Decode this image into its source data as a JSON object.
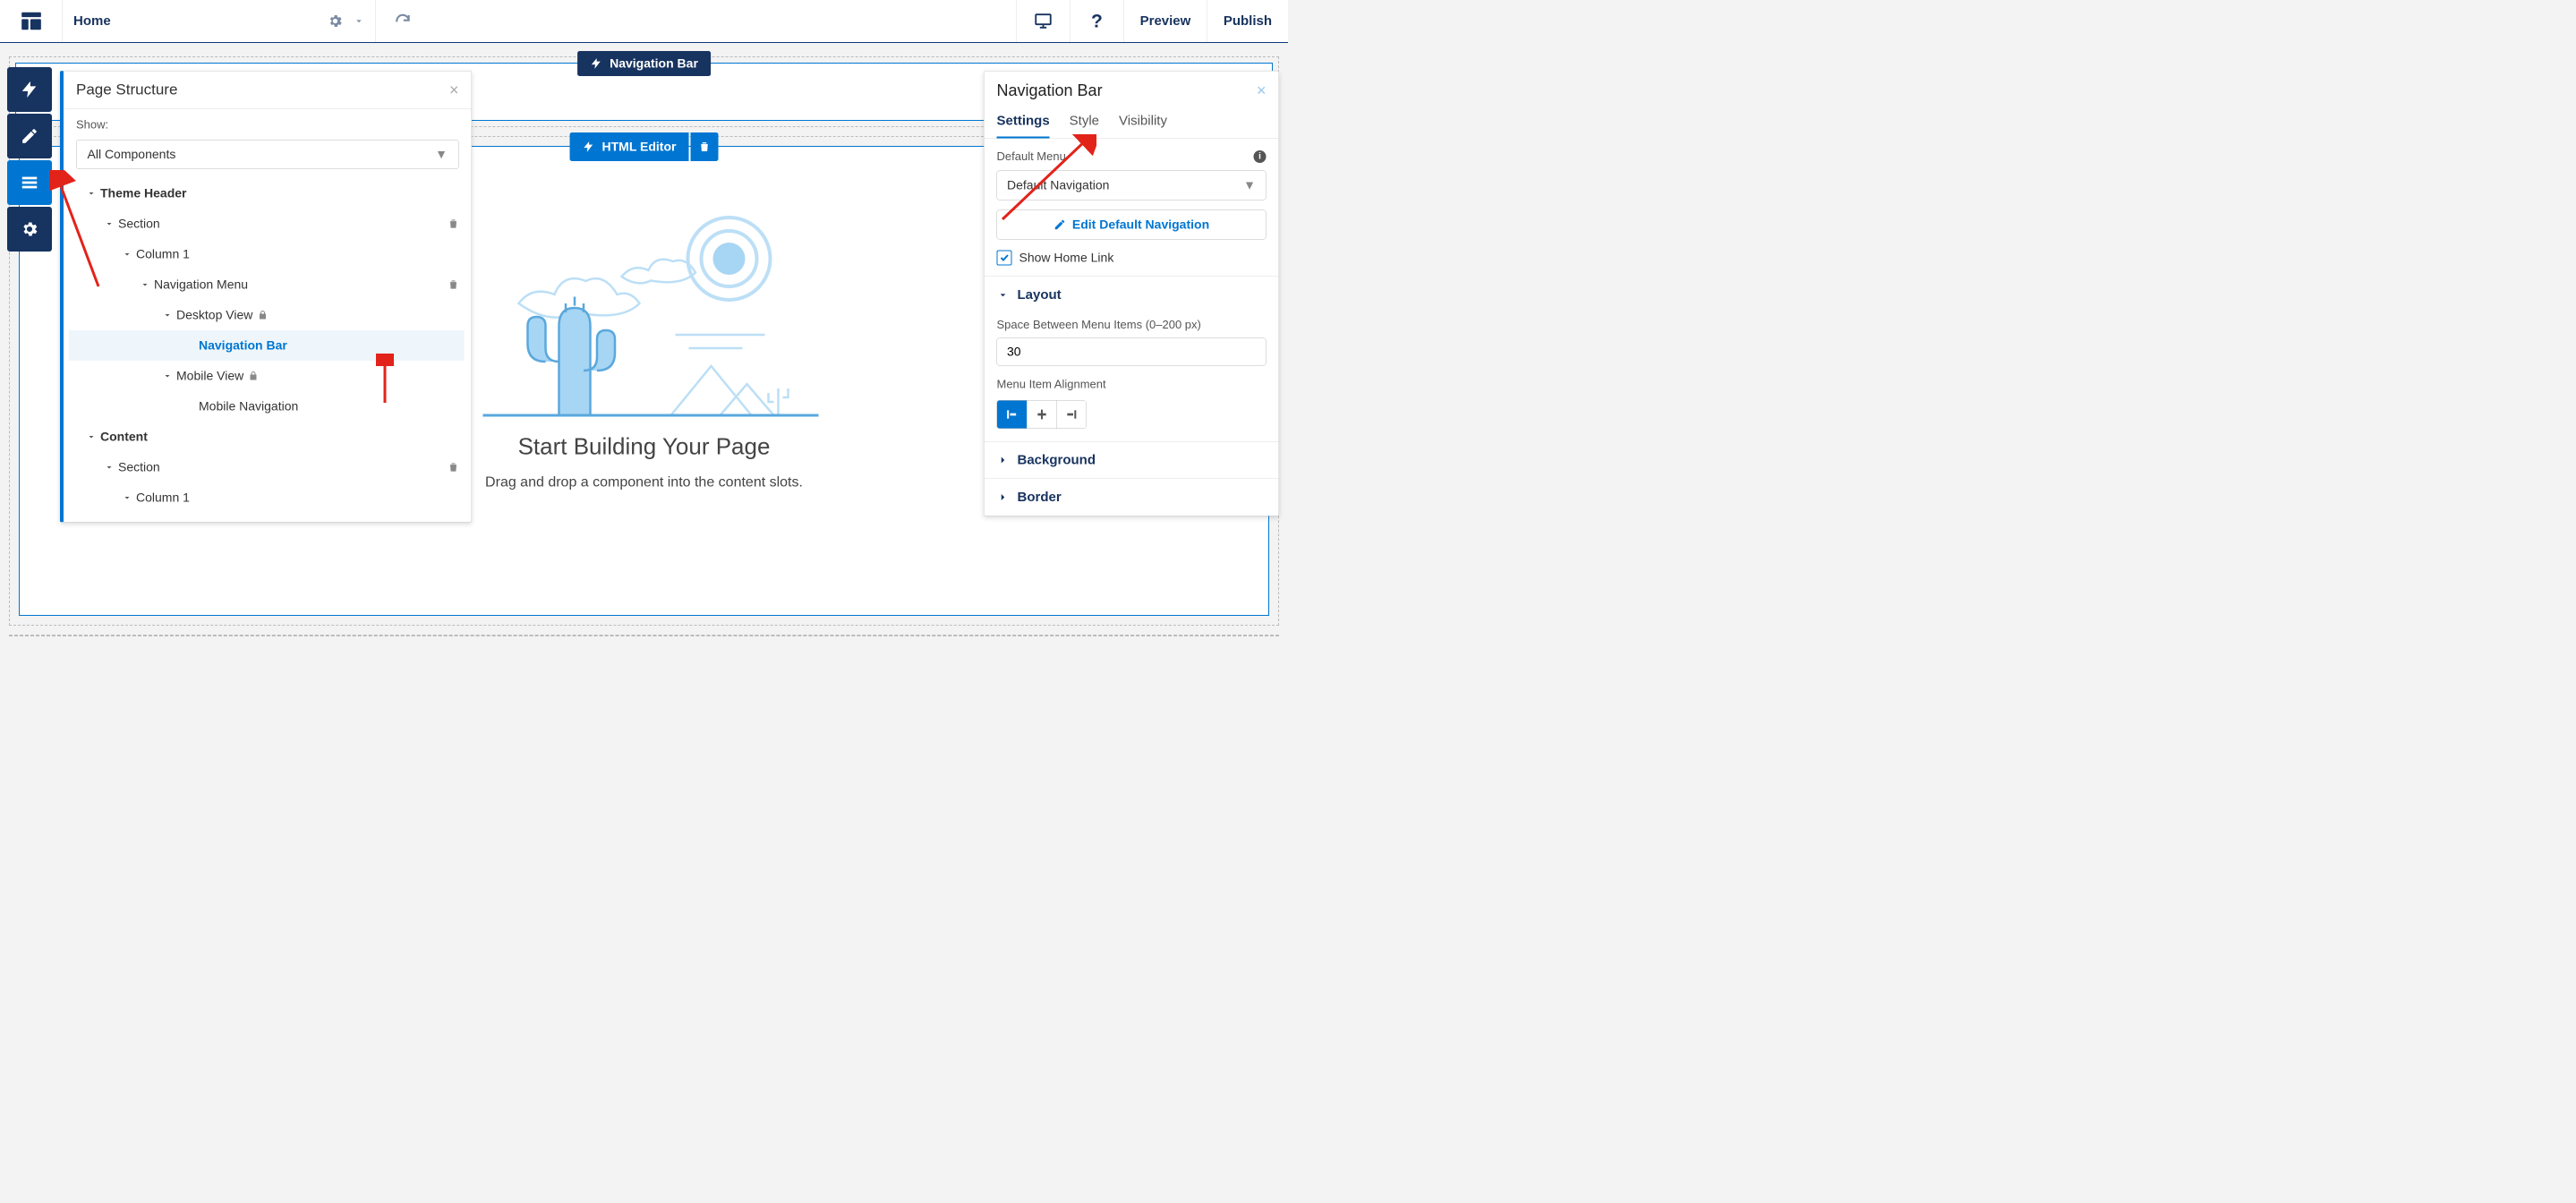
{
  "topbar": {
    "page_name": "Home",
    "preview_label": "Preview",
    "publish_label": "Publish"
  },
  "nav_pill": {
    "label": "Navigation Bar"
  },
  "editor_pill": {
    "label": "HTML Editor"
  },
  "canvas": {
    "heading": "Start Building Your Page",
    "subheading": "Drag and drop a component into the content slots."
  },
  "structure_panel": {
    "title": "Page Structure",
    "show_label": "Show:",
    "show_value": "All Components",
    "tree": {
      "theme_header": "Theme Header",
      "section1": "Section",
      "column1": "Column 1",
      "nav_menu": "Navigation Menu",
      "desktop_view": "Desktop View",
      "navigation_bar": "Navigation Bar",
      "mobile_view": "Mobile View",
      "mobile_navigation": "Mobile Navigation",
      "content": "Content",
      "section2": "Section",
      "column1b": "Column 1"
    }
  },
  "prop_panel": {
    "title": "Navigation Bar",
    "tabs": {
      "settings": "Settings",
      "style": "Style",
      "visibility": "Visibility"
    },
    "default_menu_label": "Default Menu",
    "default_menu_value": "Default Navigation",
    "edit_default_label": "Edit Default Navigation",
    "show_home_label": "Show Home Link",
    "layout_label": "Layout",
    "spacing_label": "Space Between Menu Items (0–200 px)",
    "spacing_value": "30",
    "alignment_label": "Menu Item Alignment",
    "background_label": "Background",
    "border_label": "Border"
  }
}
